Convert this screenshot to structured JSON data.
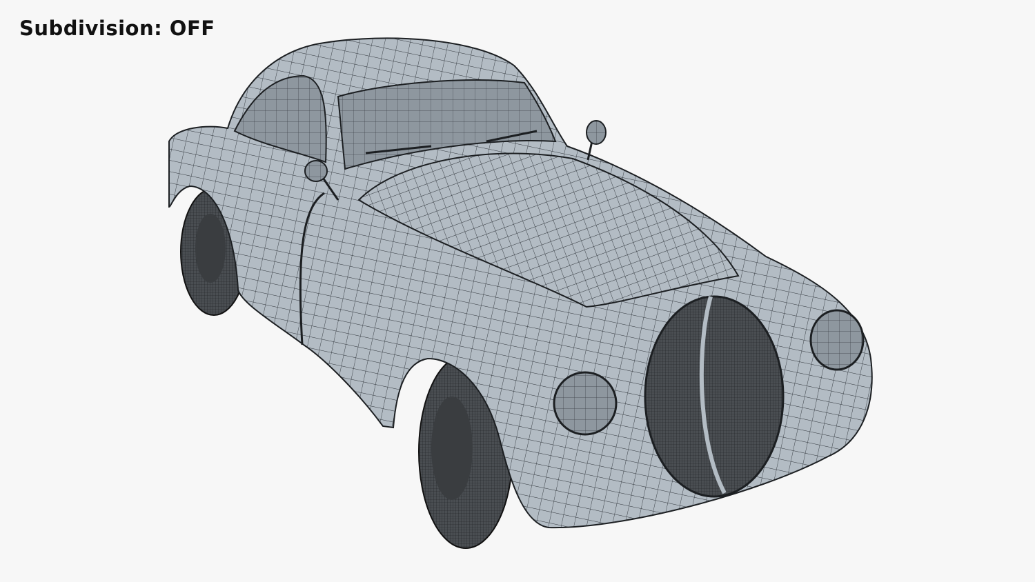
{
  "overlay": {
    "subdivision_label": "Subdivision: OFF"
  },
  "colors": {
    "background": "#f7f7f7",
    "surface": "#b3bcc4",
    "wire": "#2e3339",
    "glass": "#8e979f",
    "tire": "#3a3d40"
  }
}
